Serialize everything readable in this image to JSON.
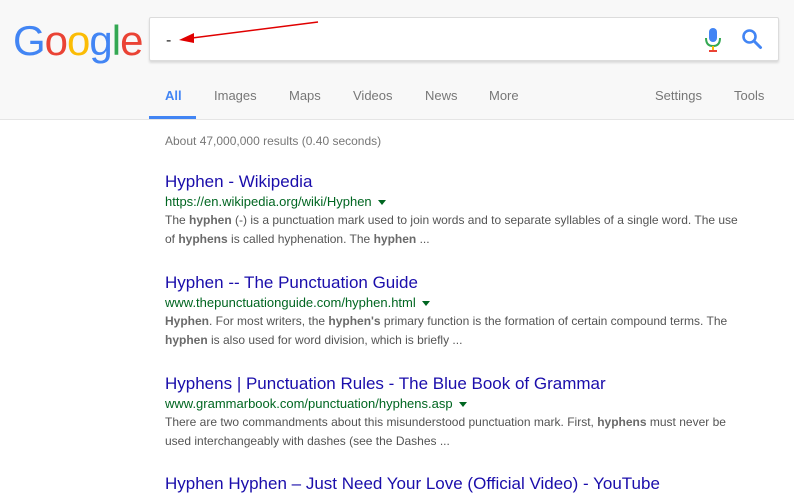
{
  "logo": {
    "letters": [
      "G",
      "o",
      "o",
      "g",
      "l",
      "e"
    ],
    "colors": [
      "#4285f4",
      "#ea4335",
      "#fbbc05",
      "#4285f4",
      "#34a853",
      "#ea4335"
    ]
  },
  "search": {
    "value": "-"
  },
  "icons": {
    "mic": "microphone-icon",
    "search": "search-icon",
    "arrow": "red-arrow-annotation"
  },
  "tabs": [
    {
      "label": "All",
      "active": true
    },
    {
      "label": "Images"
    },
    {
      "label": "Maps"
    },
    {
      "label": "Videos"
    },
    {
      "label": "News"
    },
    {
      "label": "More"
    },
    {
      "label": "Settings"
    },
    {
      "label": "Tools"
    }
  ],
  "stats": "About 47,000,000 results (0.40 seconds)",
  "results": [
    {
      "title": "Hyphen - Wikipedia",
      "url": "https://en.wikipedia.org/wiki/Hyphen",
      "snippet_parts": [
        {
          "t": "The "
        },
        {
          "t": "hyphen",
          "b": true
        },
        {
          "t": " (-) is a punctuation mark used to join words and to separate syllables of a single word. The use of "
        },
        {
          "t": "hyphens",
          "b": true
        },
        {
          "t": " is called hyphenation. The "
        },
        {
          "t": "hyphen",
          "b": true
        },
        {
          "t": " ..."
        }
      ]
    },
    {
      "title": "Hyphen -- The Punctuation Guide",
      "url": "www.thepunctuationguide.com/hyphen.html",
      "snippet_parts": [
        {
          "t": "Hyphen",
          "b": true
        },
        {
          "t": ". For most writers, the "
        },
        {
          "t": "hyphen's",
          "b": true
        },
        {
          "t": " primary function is the formation of certain compound terms. The "
        },
        {
          "t": "hyphen",
          "b": true
        },
        {
          "t": " is also used for word division, which is briefly ..."
        }
      ]
    },
    {
      "title": "Hyphens | Punctuation Rules - The Blue Book of Grammar",
      "url": "www.grammarbook.com/punctuation/hyphens.asp",
      "snippet_parts": [
        {
          "t": "There are two commandments about this misunderstood punctuation mark. First, "
        },
        {
          "t": "hyphens",
          "b": true
        },
        {
          "t": " must never be used interchangeably with dashes (see the Dashes ..."
        }
      ]
    },
    {
      "title": "Hyphen Hyphen – Just Need Your Love (Official Video) - YouTube",
      "url": "",
      "snippet_parts": []
    }
  ]
}
